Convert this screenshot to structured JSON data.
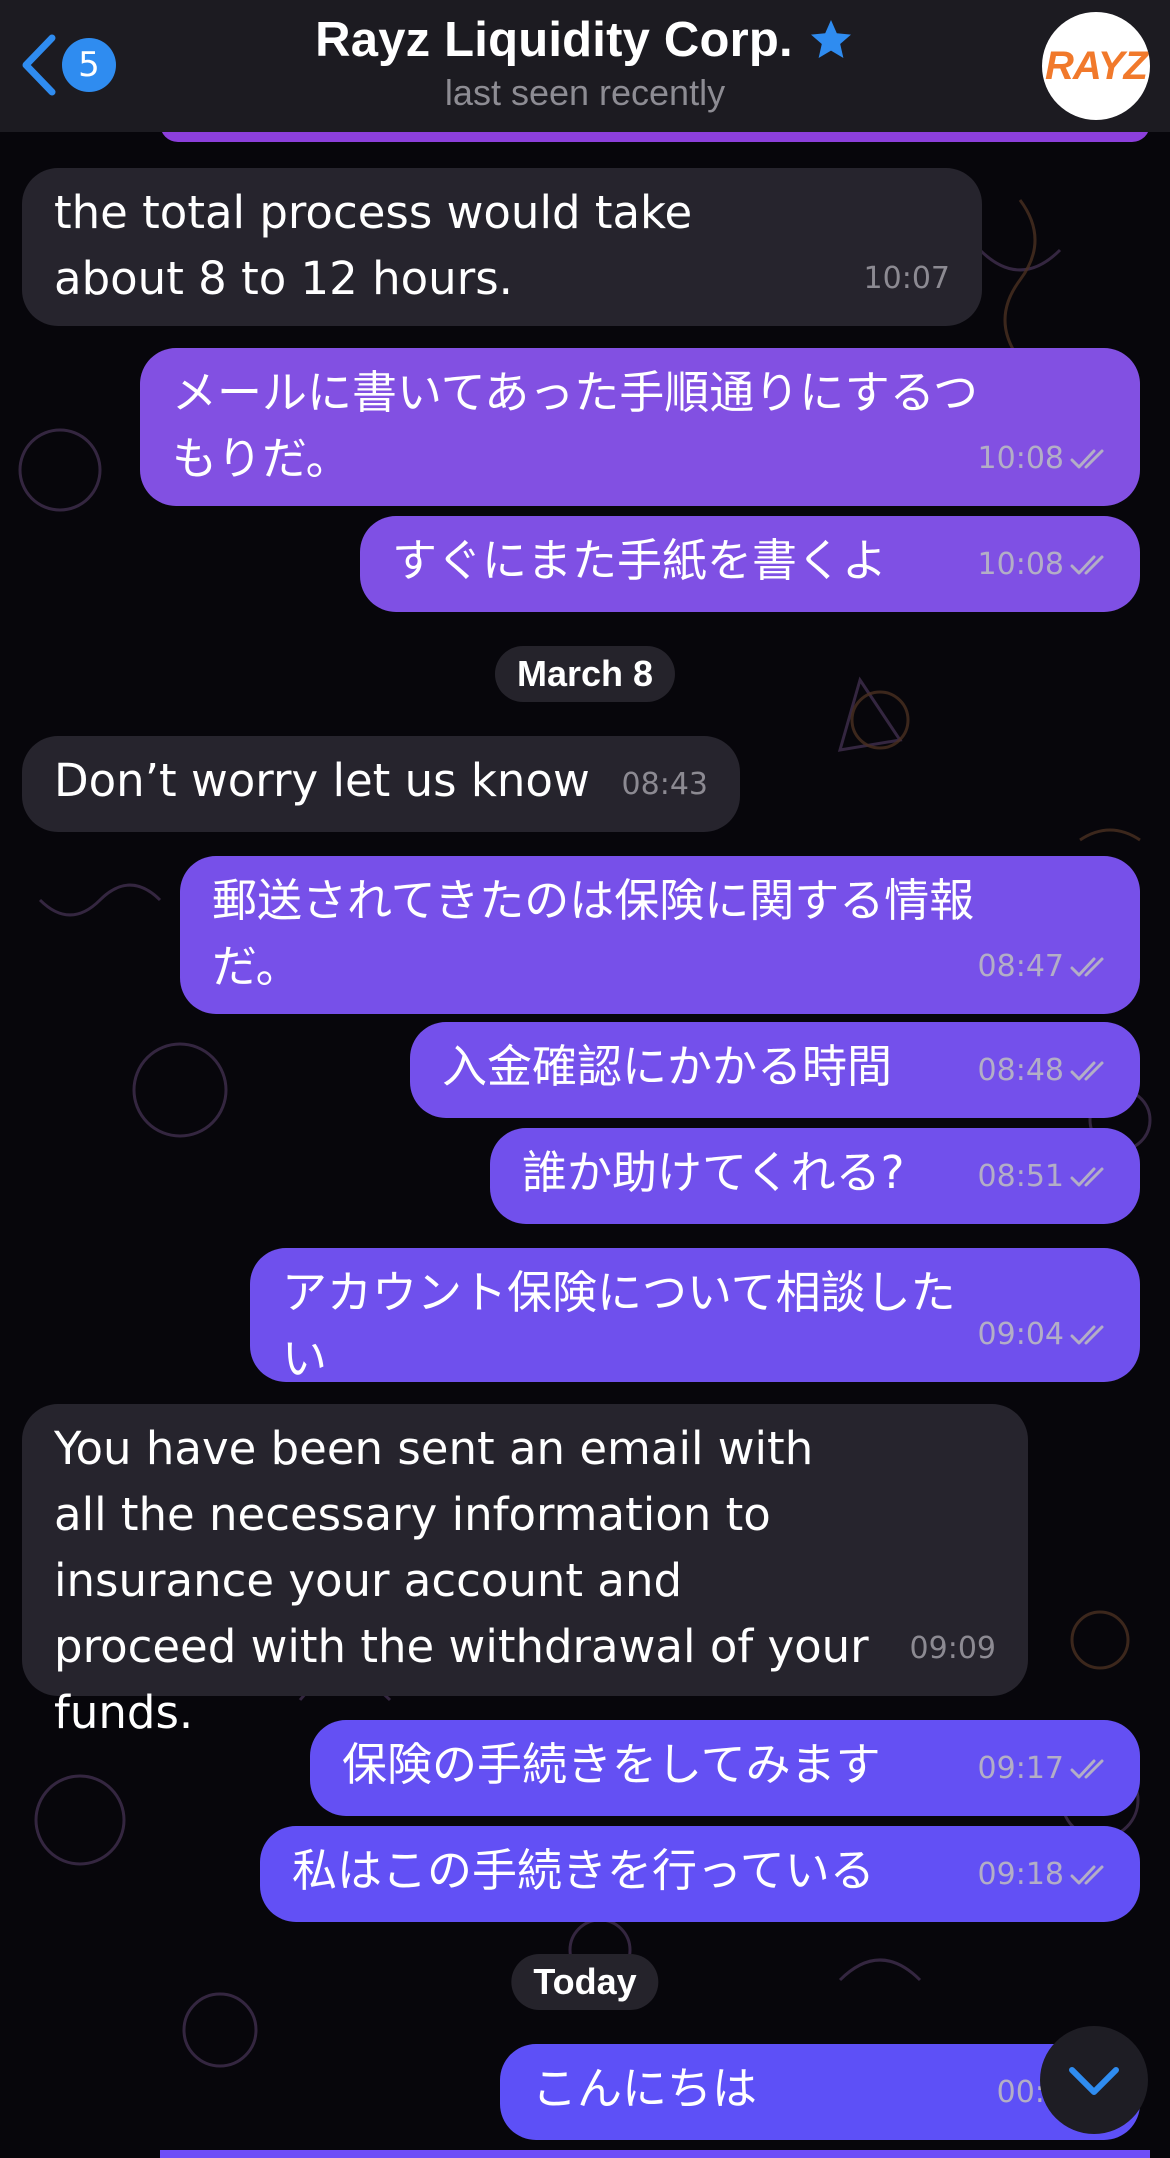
{
  "header": {
    "back_count": "5",
    "title": "Rayz Liquidity Corp.",
    "status": "last seen recently",
    "avatar_text": "RAYZ"
  },
  "messages": [
    {
      "dir": "in",
      "text": "the total process would take about 8 to 12 hours.",
      "time": "10:07"
    },
    {
      "dir": "out",
      "text": "メールに書いてあった手順通りにするつもりだ。",
      "time": "10:08"
    },
    {
      "dir": "out",
      "text": "すぐにまた手紙を書くよ",
      "time": "10:08"
    },
    {
      "dir": "in",
      "text": "Don’t worry let us know",
      "time": "08:43"
    },
    {
      "dir": "out",
      "text": "郵送されてきたのは保険に関する情報だ。",
      "time": "08:47"
    },
    {
      "dir": "out",
      "text": "入金確認にかかる時間",
      "time": "08:48"
    },
    {
      "dir": "out",
      "text": "誰か助けてくれる?",
      "time": "08:51"
    },
    {
      "dir": "out",
      "text": "アカウント保険について相談したい",
      "time": "09:04"
    },
    {
      "dir": "in",
      "text": "You have been sent an email with all the necessary information to insurance your account and proceed with the withdrawal of your funds.",
      "time": "09:09"
    },
    {
      "dir": "out",
      "text": "保険の手続きをしてみます",
      "time": "09:17"
    },
    {
      "dir": "out",
      "text": "私はこの手続きを行っている",
      "time": "09:18"
    },
    {
      "dir": "out",
      "text": "こんにちは",
      "time": "00:1"
    }
  ],
  "dates": [
    "March 8",
    "Today"
  ],
  "colors": {
    "outgoing_top": "#8e42dc",
    "outgoing_bottom": "#5a4ff8",
    "incoming": "#26242d",
    "accent": "#2f8cf0"
  },
  "icons": {
    "back": "chevron-left-icon",
    "star": "star-icon",
    "read": "double-check-icon",
    "scroll": "chevron-down-icon"
  }
}
